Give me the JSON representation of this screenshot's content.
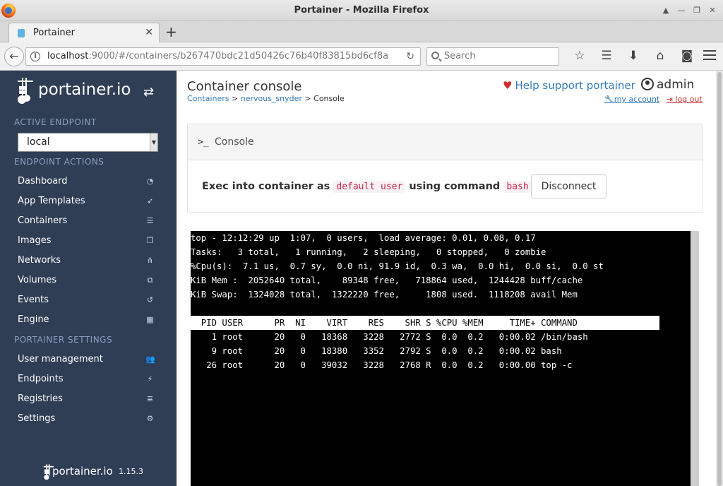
{
  "browser": {
    "window_title": "Portainer - Mozilla Firefox",
    "tab_title": "Portainer",
    "url_host": "localhost",
    "url_rest": ":9000/#/containers/b267470bdc21d50426c76b40f83815bd6cf8a",
    "search_placeholder": "Search"
  },
  "sidebar": {
    "brand": "portainer.io",
    "active_endpoint_heading": "ACTIVE ENDPOINT",
    "endpoint_value": "local",
    "endpoint_actions_heading": "ENDPOINT ACTIONS",
    "actions": [
      {
        "label": "Dashboard",
        "icon": "dashboard-icon"
      },
      {
        "label": "App Templates",
        "icon": "rocket-icon"
      },
      {
        "label": "Containers",
        "icon": "server-icon"
      },
      {
        "label": "Images",
        "icon": "clone-icon"
      },
      {
        "label": "Networks",
        "icon": "sitemap-icon"
      },
      {
        "label": "Volumes",
        "icon": "cubes-icon"
      },
      {
        "label": "Events",
        "icon": "history-icon"
      },
      {
        "label": "Engine",
        "icon": "th-icon"
      }
    ],
    "settings_heading": "PORTAINER SETTINGS",
    "settings": [
      {
        "label": "User management",
        "icon": "users-icon"
      },
      {
        "label": "Endpoints",
        "icon": "plug-icon"
      },
      {
        "label": "Registries",
        "icon": "database-icon"
      },
      {
        "label": "Settings",
        "icon": "cogs-icon"
      }
    ],
    "footer_brand": "portainer.io",
    "version": "1.15.3"
  },
  "header": {
    "title": "Container console",
    "breadcrumb": {
      "containers": "Containers",
      "sep1": " > ",
      "container_name": "nervous_snyder",
      "sep2": " > ",
      "current": "Console"
    },
    "help_text": "Help support portainer",
    "username": "admin",
    "my_account": "my account",
    "log_out": "log out"
  },
  "console_widget": {
    "title": "Console",
    "exec_prefix": "Exec into container as",
    "user_value": "default user",
    "exec_middle": "using command",
    "command_value": "bash",
    "disconnect_label": "Disconnect"
  },
  "terminal": {
    "lines": [
      "top - 12:12:29 up  1:07,  0 users,  load average: 0.01, 0.08, 0.17",
      "Tasks:   3 total,   1 running,   2 sleeping,   0 stopped,   0 zombie",
      "%Cpu(s):  7.1 us,  0.7 sy,  0.0 ni, 91.9 id,  0.3 wa,  0.0 hi,  0.0 si,  0.0 st",
      "KiB Mem :  2052640 total,    89348 free,   718864 used,  1244428 buff/cache",
      "KiB Swap:  1324028 total,  1322220 free,     1808 used.  1118208 avail Mem"
    ],
    "header": "  PID USER      PR  NI    VIRT    RES    SHR S %CPU %MEM     TIME+ COMMAND",
    "processes": [
      "    1 root      20   0   18368   3228   2772 S  0.0  0.2   0:00.02 /bin/bash",
      "    9 root      20   0   18380   3352   2792 S  0.0  0.2   0:00.02 bash",
      "   26 root      20   0   39032   3228   2768 R  0.0  0.2   0:00.00 top -c"
    ]
  }
}
